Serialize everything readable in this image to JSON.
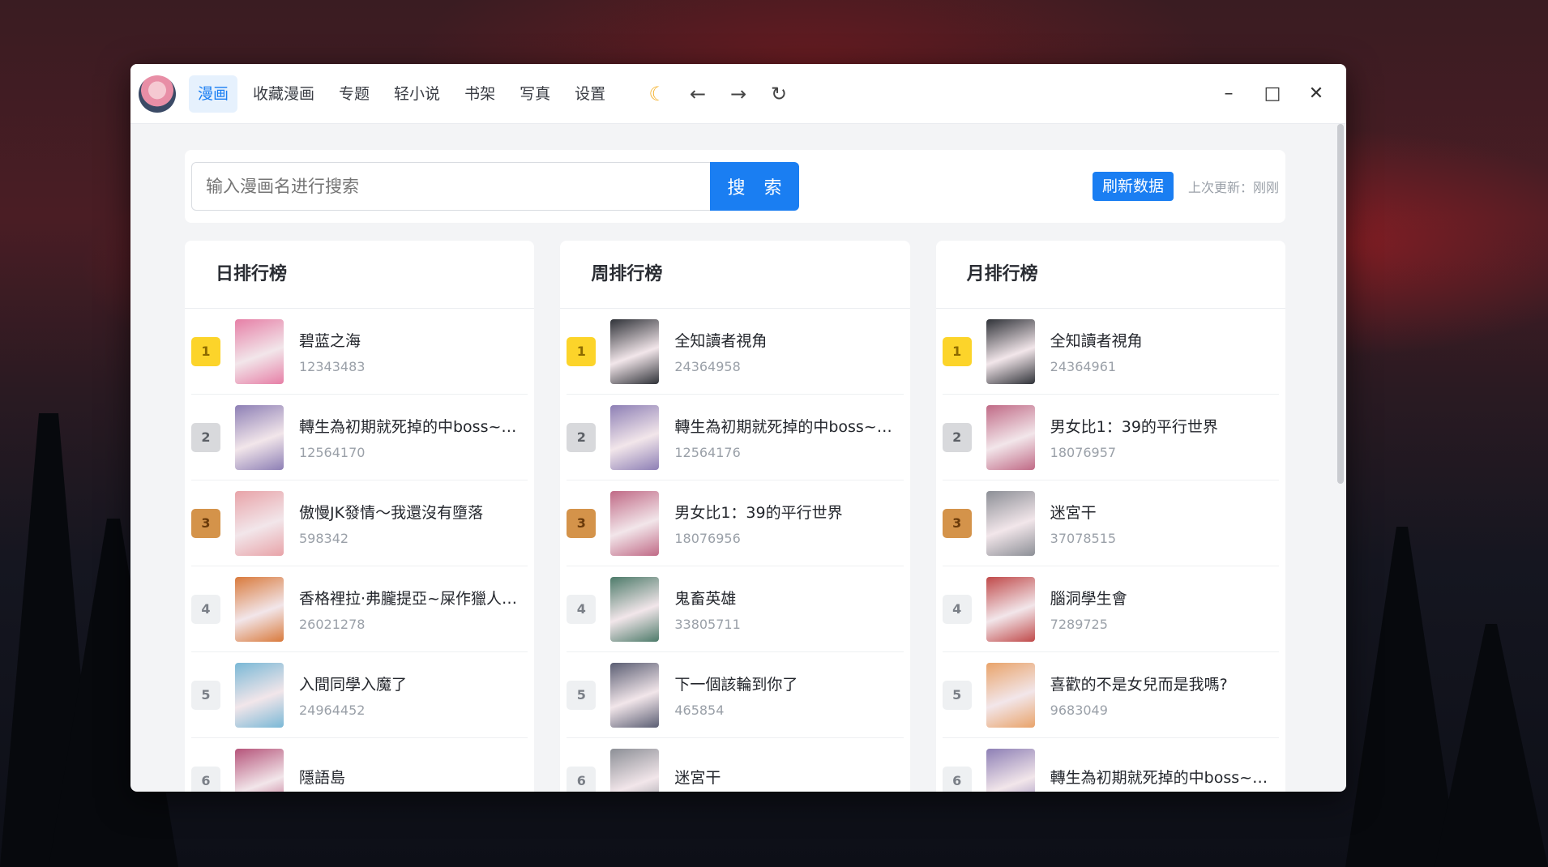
{
  "nav": {
    "items": [
      {
        "label": "漫画",
        "active": true
      },
      {
        "label": "收藏漫画",
        "active": false
      },
      {
        "label": "专题",
        "active": false
      },
      {
        "label": "轻小说",
        "active": false
      },
      {
        "label": "书架",
        "active": false
      },
      {
        "label": "写真",
        "active": false
      },
      {
        "label": "设置",
        "active": false
      }
    ]
  },
  "toolbar": {
    "theme_icon": "moon-icon",
    "back_icon": "arrow-left-icon",
    "forward_icon": "arrow-right-icon",
    "refresh_icon": "refresh-icon"
  },
  "search": {
    "placeholder": "输入漫画名进行搜索",
    "value": "",
    "button_label": "搜 索"
  },
  "refresh": {
    "button_label": "刷新数据",
    "last_update": "上次更新：刚刚"
  },
  "panels": [
    {
      "title": "日排行榜",
      "items": [
        {
          "rank": "1",
          "name": "碧蓝之海",
          "id": "12343483",
          "cover": "#e67fa6"
        },
        {
          "rank": "2",
          "name": "轉生為初期就死掉的中boss~將…",
          "id": "12564170",
          "cover": "#8d7fb5"
        },
        {
          "rank": "3",
          "name": "傲慢JK發情～我還沒有墮落",
          "id": "598342",
          "cover": "#e8a3a8"
        },
        {
          "rank": "4",
          "name": "香格裡拉·弗朧提亞~屎作獵人…",
          "id": "26021278",
          "cover": "#d97a3c"
        },
        {
          "rank": "5",
          "name": "入間同學入魔了",
          "id": "24964452",
          "cover": "#7ab8d6"
        },
        {
          "rank": "6",
          "name": "隱語島",
          "id": "",
          "cover": "#b5547a"
        }
      ]
    },
    {
      "title": "周排行榜",
      "items": [
        {
          "rank": "1",
          "name": "全知讀者視角",
          "id": "24364958",
          "cover": "#2f3238"
        },
        {
          "rank": "2",
          "name": "轉生為初期就死掉的中boss~將…",
          "id": "12564176",
          "cover": "#8d7fb5"
        },
        {
          "rank": "3",
          "name": "男女比1：39的平行世界",
          "id": "18076956",
          "cover": "#c06a86"
        },
        {
          "rank": "4",
          "name": "鬼畜英雄",
          "id": "33805711",
          "cover": "#4d7b6a"
        },
        {
          "rank": "5",
          "name": "下一個該輪到你了",
          "id": "465854",
          "cover": "#5b5e73"
        },
        {
          "rank": "6",
          "name": "迷宮干",
          "id": "",
          "cover": "#8c8f96"
        }
      ]
    },
    {
      "title": "月排行榜",
      "items": [
        {
          "rank": "1",
          "name": "全知讀者視角",
          "id": "24364961",
          "cover": "#2f3238"
        },
        {
          "rank": "2",
          "name": "男女比1：39的平行世界",
          "id": "18076957",
          "cover": "#c06a86"
        },
        {
          "rank": "3",
          "name": "迷宮干",
          "id": "37078515",
          "cover": "#8c8f96"
        },
        {
          "rank": "4",
          "name": "腦洞學生會",
          "id": "7289725",
          "cover": "#c04a4a"
        },
        {
          "rank": "5",
          "name": "喜歡的不是女兒而是我嗎?",
          "id": "9683049",
          "cover": "#e9a36a"
        },
        {
          "rank": "6",
          "name": "轉生為初期就死掉的中boss~將…",
          "id": "",
          "cover": "#8d7fb5"
        }
      ]
    }
  ],
  "colors": {
    "accent": "#1a7ef2",
    "gold": "#fcd42a",
    "silver": "#d8d9dc",
    "bronze": "#d4934a"
  }
}
